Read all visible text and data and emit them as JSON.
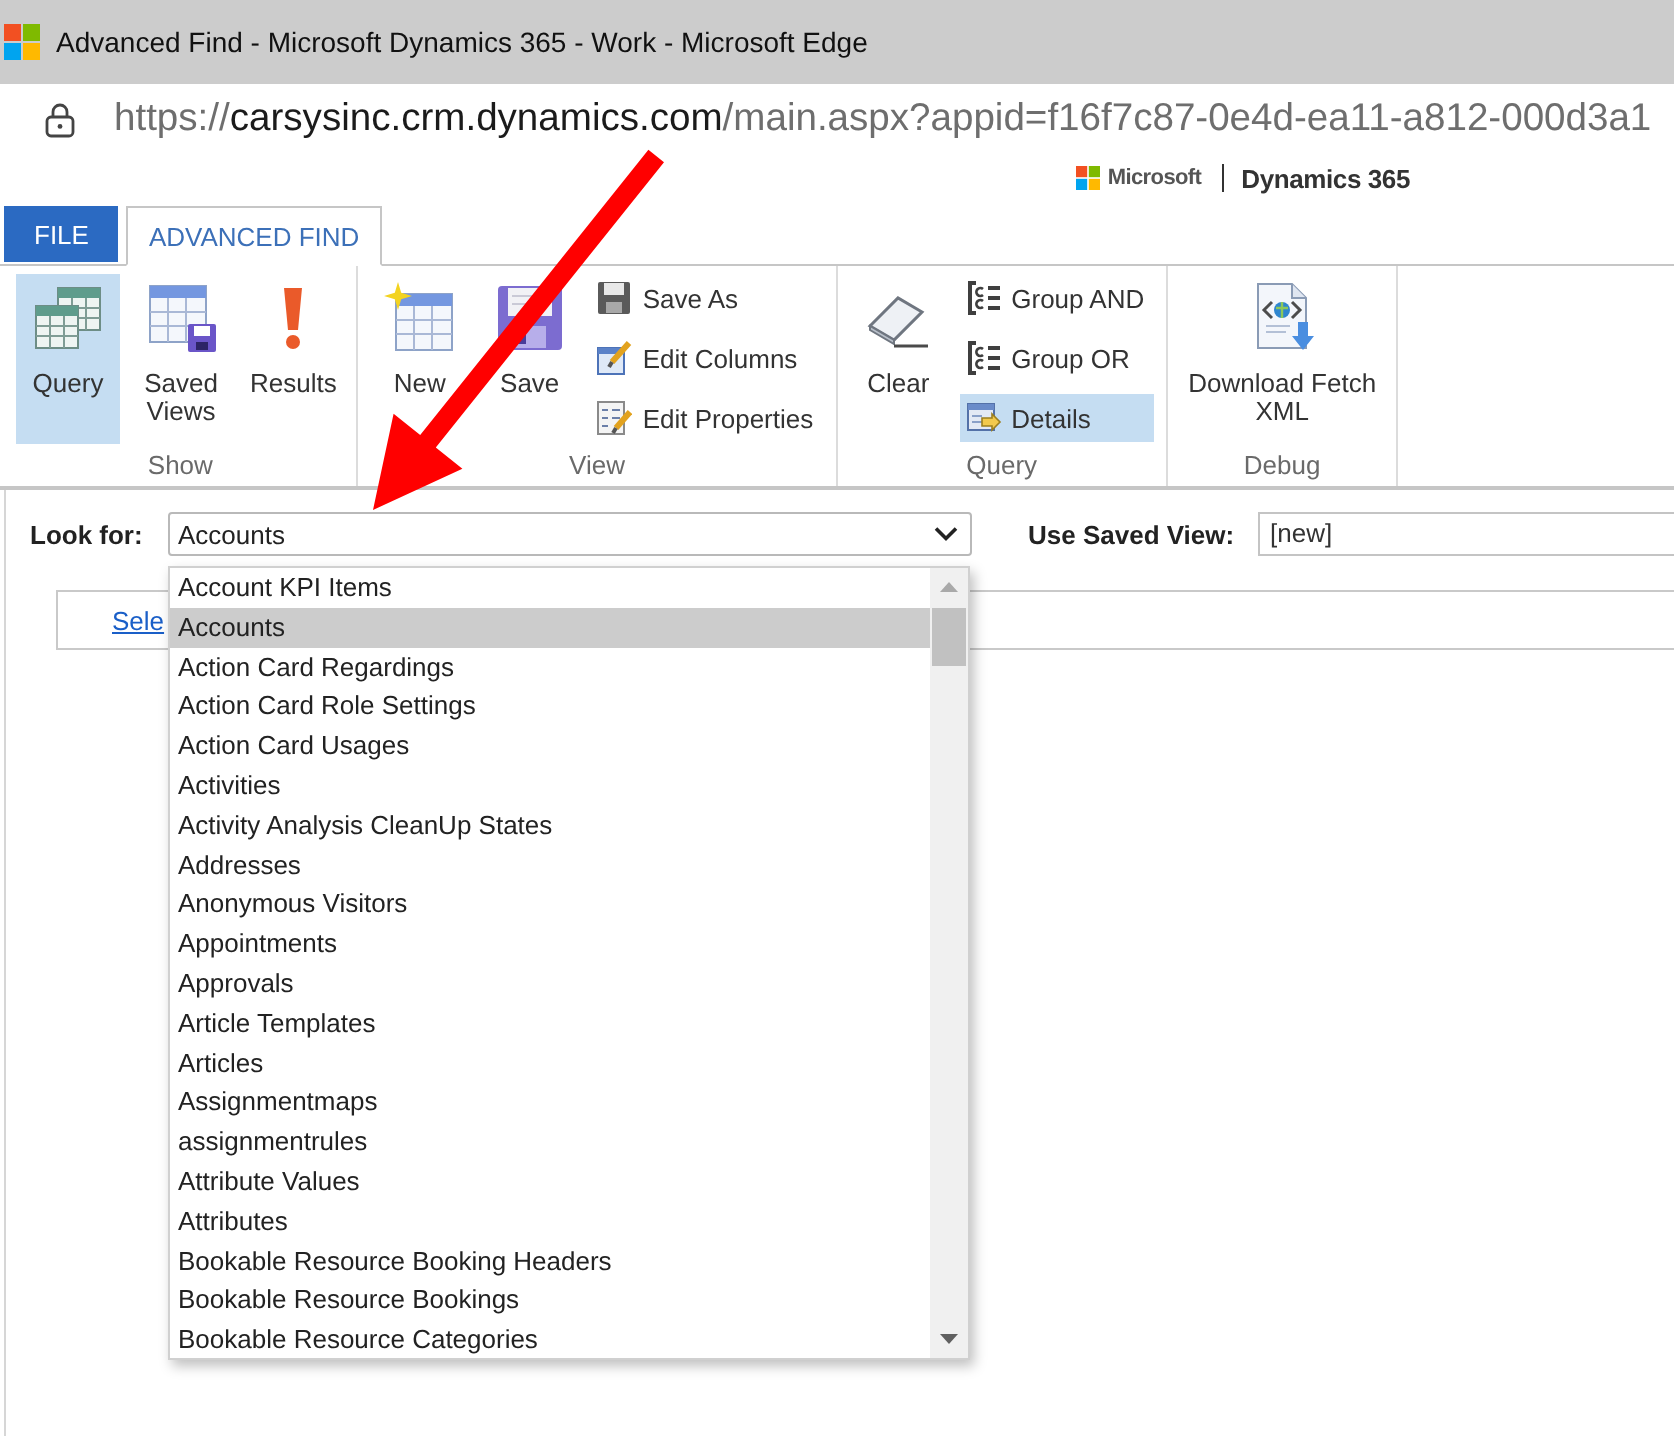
{
  "window": {
    "title": "Advanced Find - Microsoft Dynamics 365 - Work - Microsoft Edge"
  },
  "address_bar": {
    "scheme": "https://",
    "host": "carsysinc.crm.dynamics.com",
    "path": "/main.aspx?appid=f16f7c87-0e4d-ea11-a812-000d3a1"
  },
  "brand": {
    "company": "Microsoft",
    "product": "Dynamics 365"
  },
  "ribbon_tabs": [
    {
      "label": "FILE",
      "kind": "file",
      "selected": false
    },
    {
      "label": "ADVANCED FIND",
      "kind": "tab",
      "selected": true
    }
  ],
  "ribbon_groups": [
    {
      "label": "Show",
      "buttons": [
        {
          "label": "Query",
          "kind": "large",
          "selected": true
        },
        {
          "label": "Saved Views",
          "kind": "large",
          "selected": false
        },
        {
          "label": "Results",
          "kind": "large",
          "selected": false
        }
      ]
    },
    {
      "label": "View",
      "buttons": [
        {
          "label": "New",
          "kind": "large",
          "selected": false
        },
        {
          "label": "Save",
          "kind": "large",
          "selected": false
        },
        {
          "label": "Save As",
          "kind": "small",
          "selected": false
        },
        {
          "label": "Edit Columns",
          "kind": "small",
          "selected": false
        },
        {
          "label": "Edit Properties",
          "kind": "small",
          "selected": false
        }
      ]
    },
    {
      "label": "Query",
      "buttons": [
        {
          "label": "Clear",
          "kind": "large",
          "selected": false
        },
        {
          "label": "Group AND",
          "kind": "small",
          "selected": false
        },
        {
          "label": "Group OR",
          "kind": "small",
          "selected": false
        },
        {
          "label": "Details",
          "kind": "small",
          "selected": true
        }
      ]
    },
    {
      "label": "Debug",
      "buttons": [
        {
          "label": "Download Fetch XML",
          "kind": "large",
          "selected": false
        }
      ]
    }
  ],
  "look_for": {
    "label": "Look for:",
    "value": "Accounts"
  },
  "saved_view": {
    "label": "Use Saved View:",
    "value": "[new]"
  },
  "criteria": {
    "link": "Sele"
  },
  "entity_list": {
    "items": [
      {
        "label": "Account KPI Items",
        "selected": false
      },
      {
        "label": "Accounts",
        "selected": true
      },
      {
        "label": "Action Card Regardings",
        "selected": false
      },
      {
        "label": "Action Card Role Settings",
        "selected": false
      },
      {
        "label": "Action Card Usages",
        "selected": false
      },
      {
        "label": "Activities",
        "selected": false
      },
      {
        "label": "Activity Analysis CleanUp States",
        "selected": false
      },
      {
        "label": "Addresses",
        "selected": false
      },
      {
        "label": "Anonymous Visitors",
        "selected": false
      },
      {
        "label": "Appointments",
        "selected": false
      },
      {
        "label": "Approvals",
        "selected": false
      },
      {
        "label": "Article Templates",
        "selected": false
      },
      {
        "label": "Articles",
        "selected": false
      },
      {
        "label": "Assignmentmaps",
        "selected": false
      },
      {
        "label": "assignmentrules",
        "selected": false
      },
      {
        "label": "Attribute Values",
        "selected": false
      },
      {
        "label": "Attributes",
        "selected": false
      },
      {
        "label": "Bookable Resource Booking Headers",
        "selected": false
      },
      {
        "label": "Bookable Resource Bookings",
        "selected": false
      },
      {
        "label": "Bookable Resource Categories",
        "selected": false
      }
    ]
  }
}
